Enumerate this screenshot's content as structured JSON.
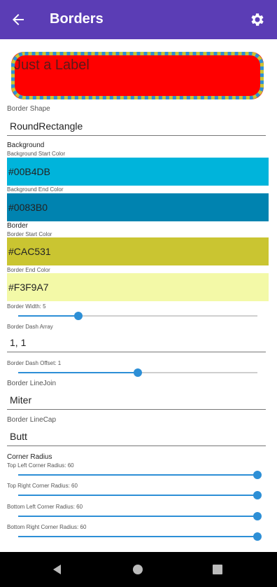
{
  "appbar": {
    "title": "Borders",
    "back_icon": "arrow-back-icon",
    "settings_icon": "gear-icon"
  },
  "preview": {
    "label": "Just a Label",
    "background_color": "#FF0000",
    "border_start_color": "#CAC531",
    "border_end_color": "#F3F9A7"
  },
  "border_shape": {
    "label": "Border Shape",
    "value": "RoundRectangle"
  },
  "background": {
    "section": "Background",
    "start_label": "Background Start Color",
    "start_value": "#00B4DB",
    "end_label": "Background End Color",
    "end_value": "#0083B0"
  },
  "border": {
    "section": "Border",
    "start_label": "Border Start Color",
    "start_value": "#CAC531",
    "end_label": "Border End Color",
    "end_value": "#F3F9A7"
  },
  "border_width": {
    "label": "Border Width: 5",
    "fraction": 0.25
  },
  "dash_array": {
    "label": "Border Dash Array",
    "value": "1, 1"
  },
  "dash_offset": {
    "label": "Border Dash Offset: 1",
    "fraction": 0.5
  },
  "line_join": {
    "label": "Border LineJoin",
    "value": "Miter"
  },
  "line_cap": {
    "label": "Border LineCap",
    "value": "Butt"
  },
  "corner_radius": {
    "section": "Corner Radius",
    "top_left": {
      "label": "Top Left Corner Radius: 60",
      "fraction": 1.0
    },
    "top_right": {
      "label": "Top Right Corner Radius: 60",
      "fraction": 1.0
    },
    "bottom_left": {
      "label": "Bottom Left Corner Radius: 60",
      "fraction": 1.0
    },
    "bottom_right": {
      "label": "Bottom Right Corner Radius: 60",
      "fraction": 1.0
    }
  },
  "accent_color": "#2D8FD6",
  "appbar_color": "#5B3DB5",
  "navbar": {
    "back_icon": "nav-back-icon",
    "home_icon": "nav-home-icon",
    "recents_icon": "nav-recents-icon"
  }
}
